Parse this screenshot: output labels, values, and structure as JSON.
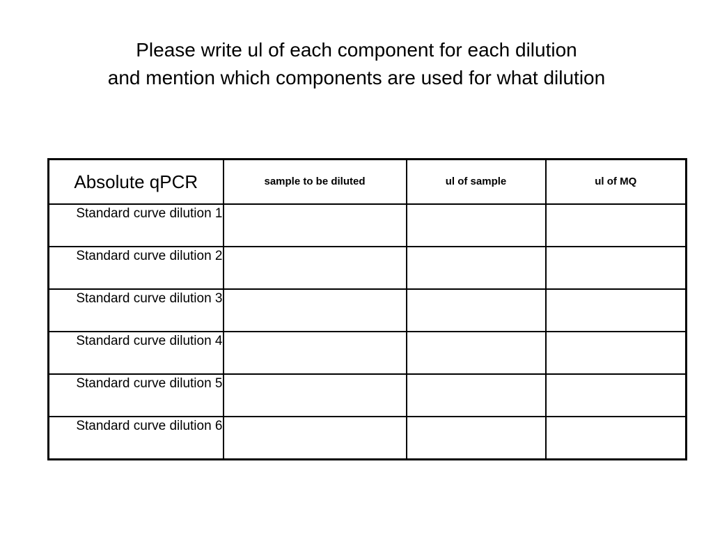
{
  "slide": {
    "title_lines": [
      "Please write ul of each component for each dilution",
      "and mention which components are used for what dilution"
    ],
    "background_color": "#ffffff",
    "text_color": "#000000",
    "border_color": "#000000"
  },
  "table": {
    "corner_header": "Absolute qPCR",
    "column_headers": [
      "sample to be diluted",
      "ul of sample",
      "ul of MQ"
    ],
    "rows": [
      {
        "label": "Standard  curve dilution 1",
        "cells": [
          "",
          "",
          ""
        ]
      },
      {
        "label": "Standard  curve dilution 2",
        "cells": [
          "",
          "",
          ""
        ]
      },
      {
        "label": "Standard  curve dilution 3",
        "cells": [
          "",
          "",
          ""
        ]
      },
      {
        "label": "Standard  curve dilution 4",
        "cells": [
          "",
          "",
          ""
        ]
      },
      {
        "label": "Standard  curve dilution 5",
        "cells": [
          "",
          "",
          ""
        ]
      },
      {
        "label": "Standard  curve dilution 6",
        "cells": [
          "",
          "",
          ""
        ]
      }
    ]
  }
}
